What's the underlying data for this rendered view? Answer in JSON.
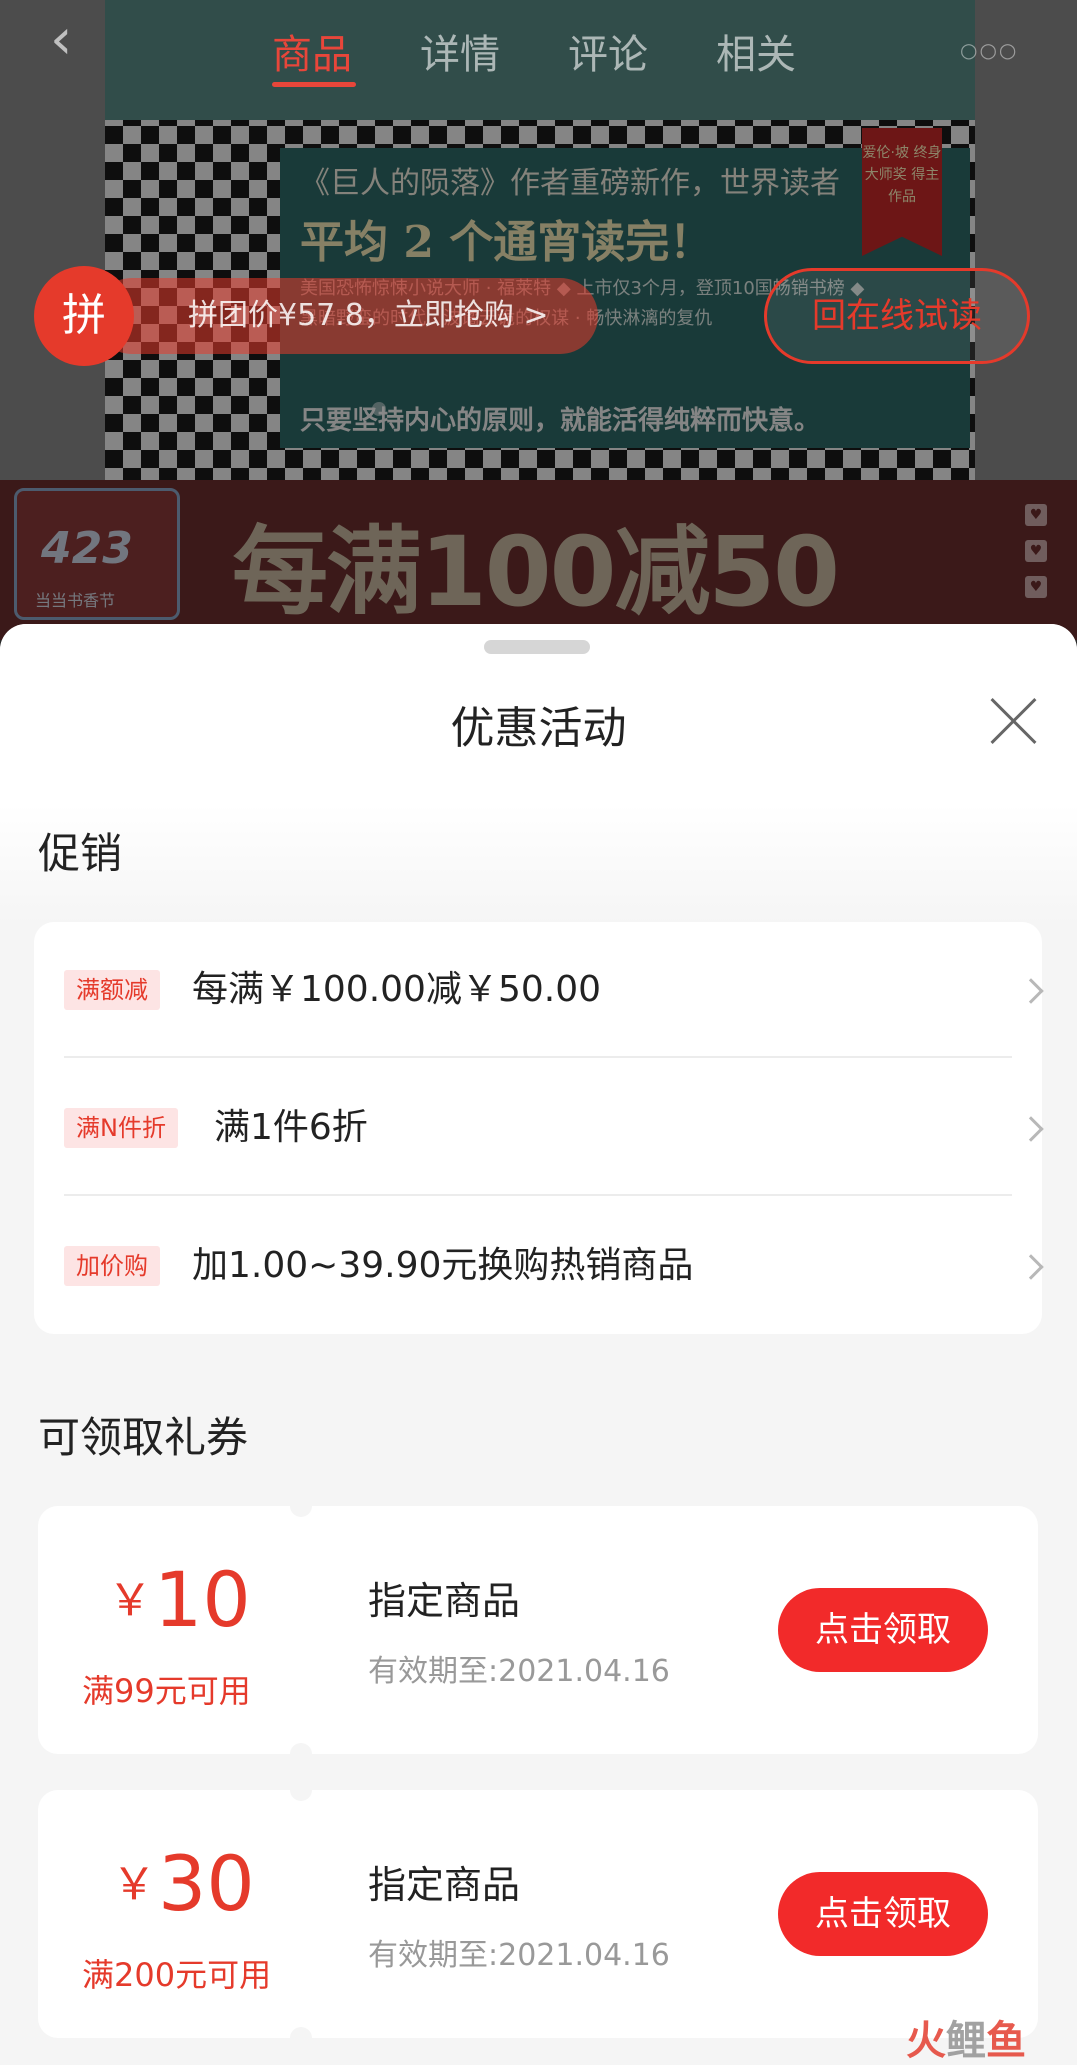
{
  "background": {
    "nav": {
      "back_icon": "back-arrow-icon",
      "tabs": [
        "商品",
        "详情",
        "评论",
        "相关"
      ],
      "active_tab": "商品",
      "more_icon": "more-dots-icon"
    },
    "book_cover": {
      "line1": "《巨人的陨落》作者重磅新作，世界读者",
      "line2": "平均 2 个通宵读完！",
      "small": "美国恐怖惊悚小说大师 · 福莱特 ◆ 上市仅3个月，登顶10国畅销书榜 ◆ 黑暗野蛮的时代 · 波谲云诡的权谋 · 畅快淋漓的复仇",
      "foot": "只要坚持内心的原则，就能活得纯粹而快意。",
      "ribbon": "爱伦·坡 终身大师奖 得主作品"
    },
    "group_buy": {
      "badge": "拼",
      "label": "拼团价¥57.8，立即抢购 >"
    },
    "trial_button": "回在线试读",
    "banner": {
      "logo_num": "423",
      "logo_sub": "当当书香节",
      "text": "每满100减50"
    }
  },
  "sheet": {
    "title": "优惠活动",
    "close_icon": "close-icon",
    "promo_section_title": "促销",
    "promotions": [
      {
        "tag": "满额减",
        "text": "每满￥100.00减￥50.00"
      },
      {
        "tag": "满N件折",
        "text": "满1件6折"
      },
      {
        "tag": "加价购",
        "text": "加1.00~39.90元换购热销商品"
      }
    ],
    "coupon_section_title": "可领取礼券",
    "coupons": [
      {
        "currency": "￥",
        "amount": "10",
        "condition": "满99元可用",
        "name": "指定商品",
        "expiry": "有效期至:2021.04.16",
        "button": "点击领取"
      },
      {
        "currency": "￥",
        "amount": "30",
        "condition": "满200元可用",
        "name": "指定商品",
        "expiry": "有效期至:2021.04.16",
        "button": "点击领取"
      }
    ]
  },
  "watermark": {
    "part1": "火",
    "part2": "鲤",
    "part3": "鱼"
  },
  "colors": {
    "accent": "#f22a2a",
    "tag_bg": "#fde4e4",
    "sheet_bg": "#f5f5f5"
  }
}
